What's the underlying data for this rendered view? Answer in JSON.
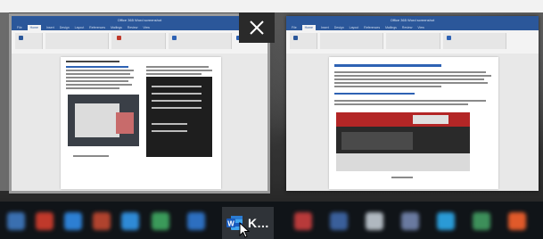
{
  "switcher": {
    "close_glyph": "✕",
    "windows": [
      {
        "id": "left",
        "app": "Word",
        "selected": true,
        "title": "Office 365 Word screenshot",
        "tabs": [
          "File",
          "Home",
          "Insert",
          "Design",
          "Layout",
          "References",
          "Mailings",
          "Review",
          "View"
        ]
      },
      {
        "id": "right",
        "app": "Word",
        "selected": false,
        "title": "Office 365 Word screenshot",
        "tabs": [
          "File",
          "Home",
          "Insert",
          "Design",
          "Layout",
          "References",
          "Mailings",
          "Review",
          "View"
        ]
      }
    ]
  },
  "taskbar": {
    "active_app_label": "K...",
    "active_app_icon": "word-icon",
    "word_logo_letter": "W",
    "accent": "#2b579a"
  }
}
